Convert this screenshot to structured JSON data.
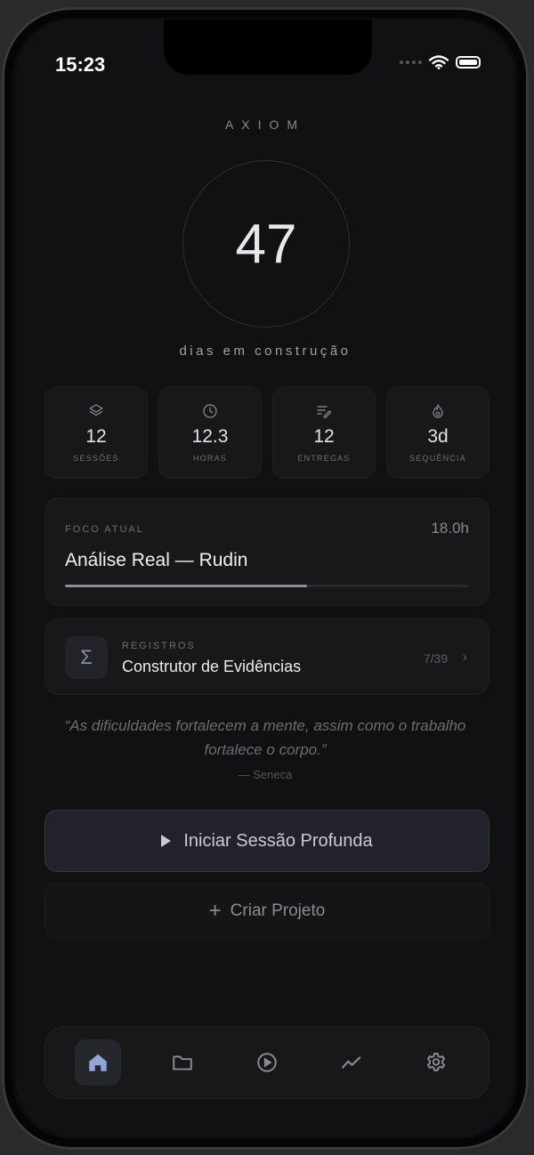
{
  "status_bar": {
    "time": "15:23"
  },
  "brand": "AXIOM",
  "ring": {
    "value": "47",
    "caption": "dias em construção"
  },
  "stats": [
    {
      "icon": "layers-icon",
      "value": "12",
      "label": "SESSÕES"
    },
    {
      "icon": "clock-icon",
      "value": "12.3",
      "label": "HORAS"
    },
    {
      "icon": "list-edit-icon",
      "value": "12",
      "label": "ENTREGAS"
    },
    {
      "icon": "flame-icon",
      "value": "3d",
      "label": "SEQUÊNCIA"
    }
  ],
  "focus": {
    "label": "FOCO ATUAL",
    "title": "Análise Real — Rudin",
    "hours": "18.0h"
  },
  "registros": {
    "icon_glyph": "Σ",
    "label": "REGISTROS",
    "title": "Construtor de Evidências",
    "count": "7/39",
    "chevron": "›"
  },
  "quote": {
    "text": "“As dificuldades fortalecem a mente, assim como o trabalho fortalece o corpo.”",
    "author": "— Seneca"
  },
  "actions": {
    "start_session": "Iniciar Sessão Profunda",
    "create_project": "Criar Projeto",
    "plus_glyph": "+"
  },
  "tabbar": {
    "items": [
      "home-icon",
      "folder-icon",
      "play-circle-icon",
      "trend-icon",
      "gear-icon"
    ],
    "active": "home-icon"
  },
  "colors": {
    "background": "#111113",
    "card": "#18181b",
    "accent": "#8b8aa0",
    "home_icon": "#8fa6d6"
  }
}
